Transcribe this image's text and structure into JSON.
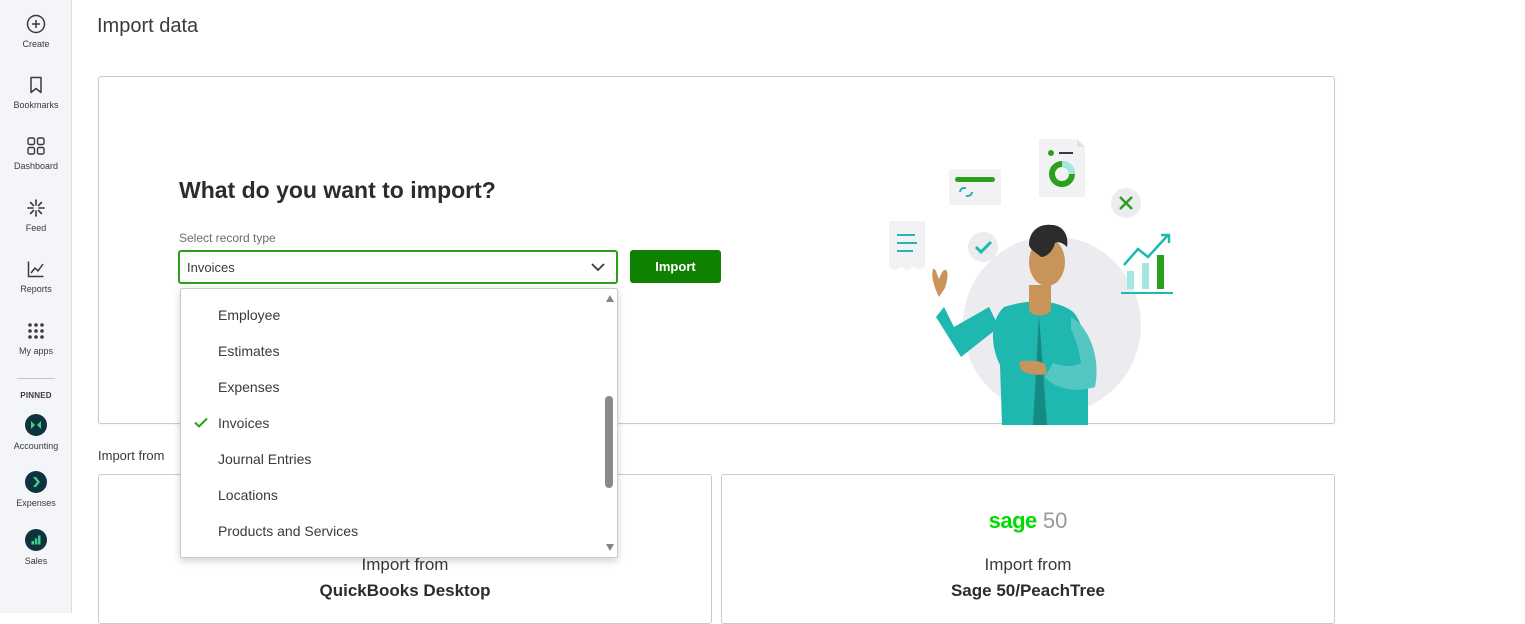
{
  "sidebar": {
    "items": [
      {
        "label": "Create",
        "icon": "plus-circle-icon"
      },
      {
        "label": "Bookmarks",
        "icon": "bookmark-icon"
      },
      {
        "label": "Dashboard",
        "icon": "dashboard-icon"
      },
      {
        "label": "Feed",
        "icon": "feed-icon"
      },
      {
        "label": "Reports",
        "icon": "reports-icon"
      },
      {
        "label": "My apps",
        "icon": "apps-grid-icon"
      }
    ],
    "pinned_label": "PINNED",
    "pinned": [
      {
        "label": "Accounting",
        "icon": "accounting-icon"
      },
      {
        "label": "Expenses",
        "icon": "expenses-icon"
      },
      {
        "label": "Sales",
        "icon": "sales-icon"
      }
    ]
  },
  "page": {
    "title": "Import data"
  },
  "hero": {
    "heading": "What do you want to import?",
    "select_label": "Select record type",
    "selected_value": "Invoices",
    "import_button": "Import"
  },
  "dropdown": {
    "options": [
      "Employee",
      "Estimates",
      "Expenses",
      "Invoices",
      "Journal Entries",
      "Locations",
      "Products and Services"
    ],
    "selected_index": 3
  },
  "import_from": {
    "label": "Import from",
    "cards": [
      {
        "subtitle": "Import from",
        "title": "QuickBooks Desktop"
      },
      {
        "subtitle": "Import from",
        "title": "Sage 50/PeachTree",
        "logo_word": "sage",
        "logo_num": "50"
      }
    ]
  },
  "colors": {
    "accent_green": "#2ca01c",
    "button_green": "#108000",
    "teal": "#1fb8b0",
    "navy": "#0d333f"
  }
}
